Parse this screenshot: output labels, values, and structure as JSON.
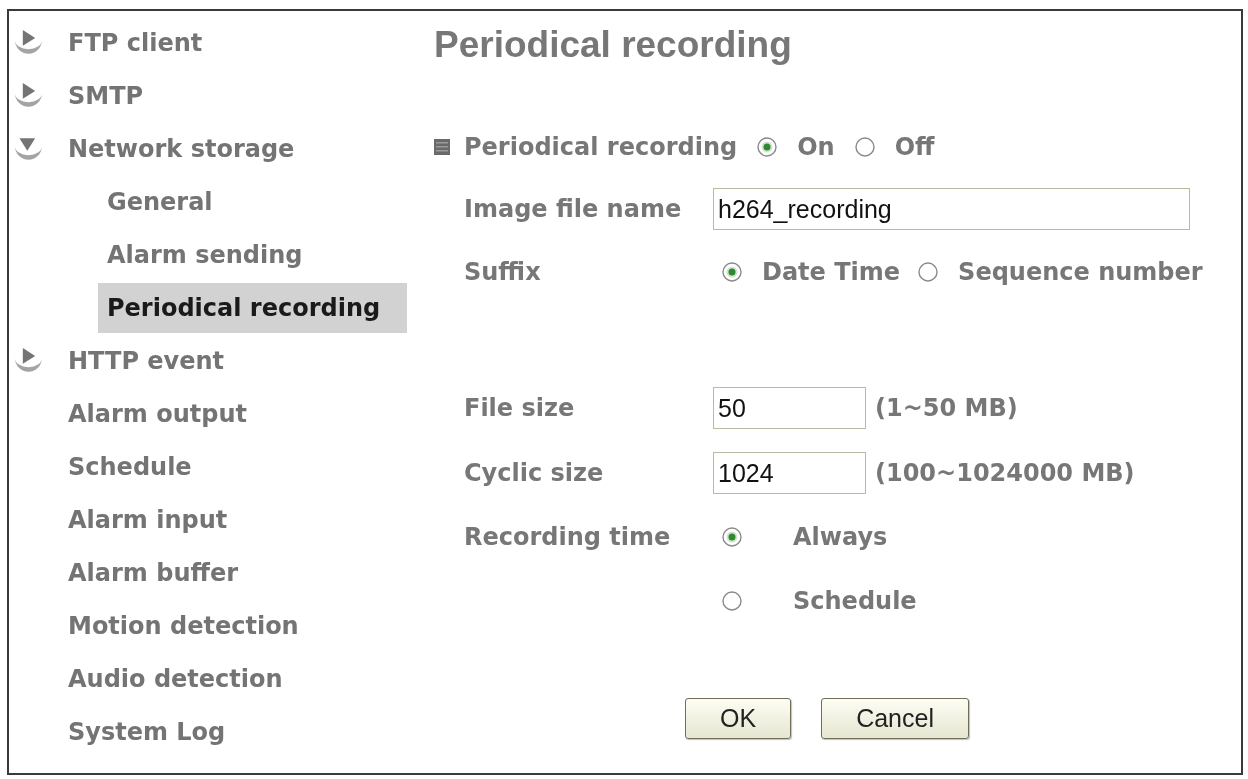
{
  "sidebar": {
    "items": [
      {
        "kind": "group",
        "label": "FTP client",
        "expanded": false,
        "selected": false
      },
      {
        "kind": "group",
        "label": "SMTP",
        "expanded": false,
        "selected": false
      },
      {
        "kind": "group",
        "label": "Network storage",
        "expanded": true,
        "selected": false,
        "children": [
          {
            "label": "General",
            "selected": false
          },
          {
            "label": "Alarm sending",
            "selected": false
          },
          {
            "label": "Periodical recording",
            "selected": true
          }
        ]
      },
      {
        "kind": "group",
        "label": "HTTP event",
        "expanded": false,
        "selected": false
      },
      {
        "kind": "link",
        "label": "Alarm output",
        "selected": false
      },
      {
        "kind": "link",
        "label": "Schedule",
        "selected": false
      },
      {
        "kind": "link",
        "label": "Alarm input",
        "selected": false
      },
      {
        "kind": "link",
        "label": "Alarm buffer",
        "selected": false
      },
      {
        "kind": "link",
        "label": "Motion detection",
        "selected": false
      },
      {
        "kind": "link",
        "label": "Audio detection",
        "selected": false
      },
      {
        "kind": "link",
        "label": "System Log",
        "selected": false
      }
    ]
  },
  "page": {
    "title": "Periodical recording",
    "section": {
      "label": "Periodical recording",
      "options": [
        {
          "label": "On",
          "selected": true
        },
        {
          "label": "Off",
          "selected": false
        }
      ]
    },
    "fields": [
      {
        "kind": "text",
        "label": "Image file name",
        "value": "h264_recording"
      },
      {
        "kind": "radio",
        "label": "Suffix",
        "options": [
          {
            "label": "Date Time",
            "selected": true
          },
          {
            "label": "Sequence number",
            "selected": false
          }
        ]
      },
      {
        "kind": "number",
        "label": "File size",
        "value": "50",
        "hint": "(1~50 MB)"
      },
      {
        "kind": "number",
        "label": "Cyclic size",
        "value": "1024",
        "hint": "(100~1024000 MB)"
      },
      {
        "kind": "radio_stack",
        "label": "Recording time",
        "options": [
          {
            "label": "Always",
            "selected": true
          },
          {
            "label": "Schedule",
            "selected": false
          }
        ]
      }
    ],
    "buttons": [
      {
        "label": "OK"
      },
      {
        "label": "Cancel"
      }
    ]
  }
}
